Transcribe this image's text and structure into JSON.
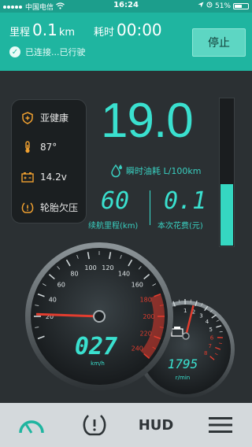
{
  "status_bar": {
    "carrier": "中国电信",
    "time": "16:24",
    "battery": "51%"
  },
  "trip": {
    "distance_label": "里程",
    "distance_value": "0.1",
    "distance_unit": "km",
    "time_label": "耗时",
    "time_value": "00:00",
    "status_text": "已连接...已行驶",
    "stop_label": "停止"
  },
  "health": {
    "condition": "亚健康",
    "temperature": "87°",
    "voltage": "14.2v",
    "tire": "轮胎欠压"
  },
  "readings": {
    "fuel_rate": "19.0",
    "fuel_rate_label": "瞬时油耗 L/100km",
    "range_value": "60",
    "range_label": "续航里程(km)",
    "cost_value": "0.1",
    "cost_label": "本次花费(元)",
    "fuel_level_fraction": 0.42
  },
  "speedometer": {
    "speed": "027",
    "unit": "km/h",
    "ticks": [
      "20",
      "40",
      "60",
      "80",
      "100",
      "120",
      "140",
      "160",
      "180",
      "200",
      "220",
      "240"
    ],
    "needle_value": 22
  },
  "tachometer": {
    "rpm": "1795",
    "unit": "r/min",
    "ticks": [
      "1",
      "2",
      "3",
      "4",
      "5",
      "6",
      "7",
      "8"
    ],
    "needle_value": 1.8
  },
  "nav": {
    "hud_label": "HUD"
  },
  "colors": {
    "accent": "#1fb5a0",
    "digits": "#3ae0cf",
    "health_orange": "#f0a030",
    "redline": "#e23d2f"
  }
}
